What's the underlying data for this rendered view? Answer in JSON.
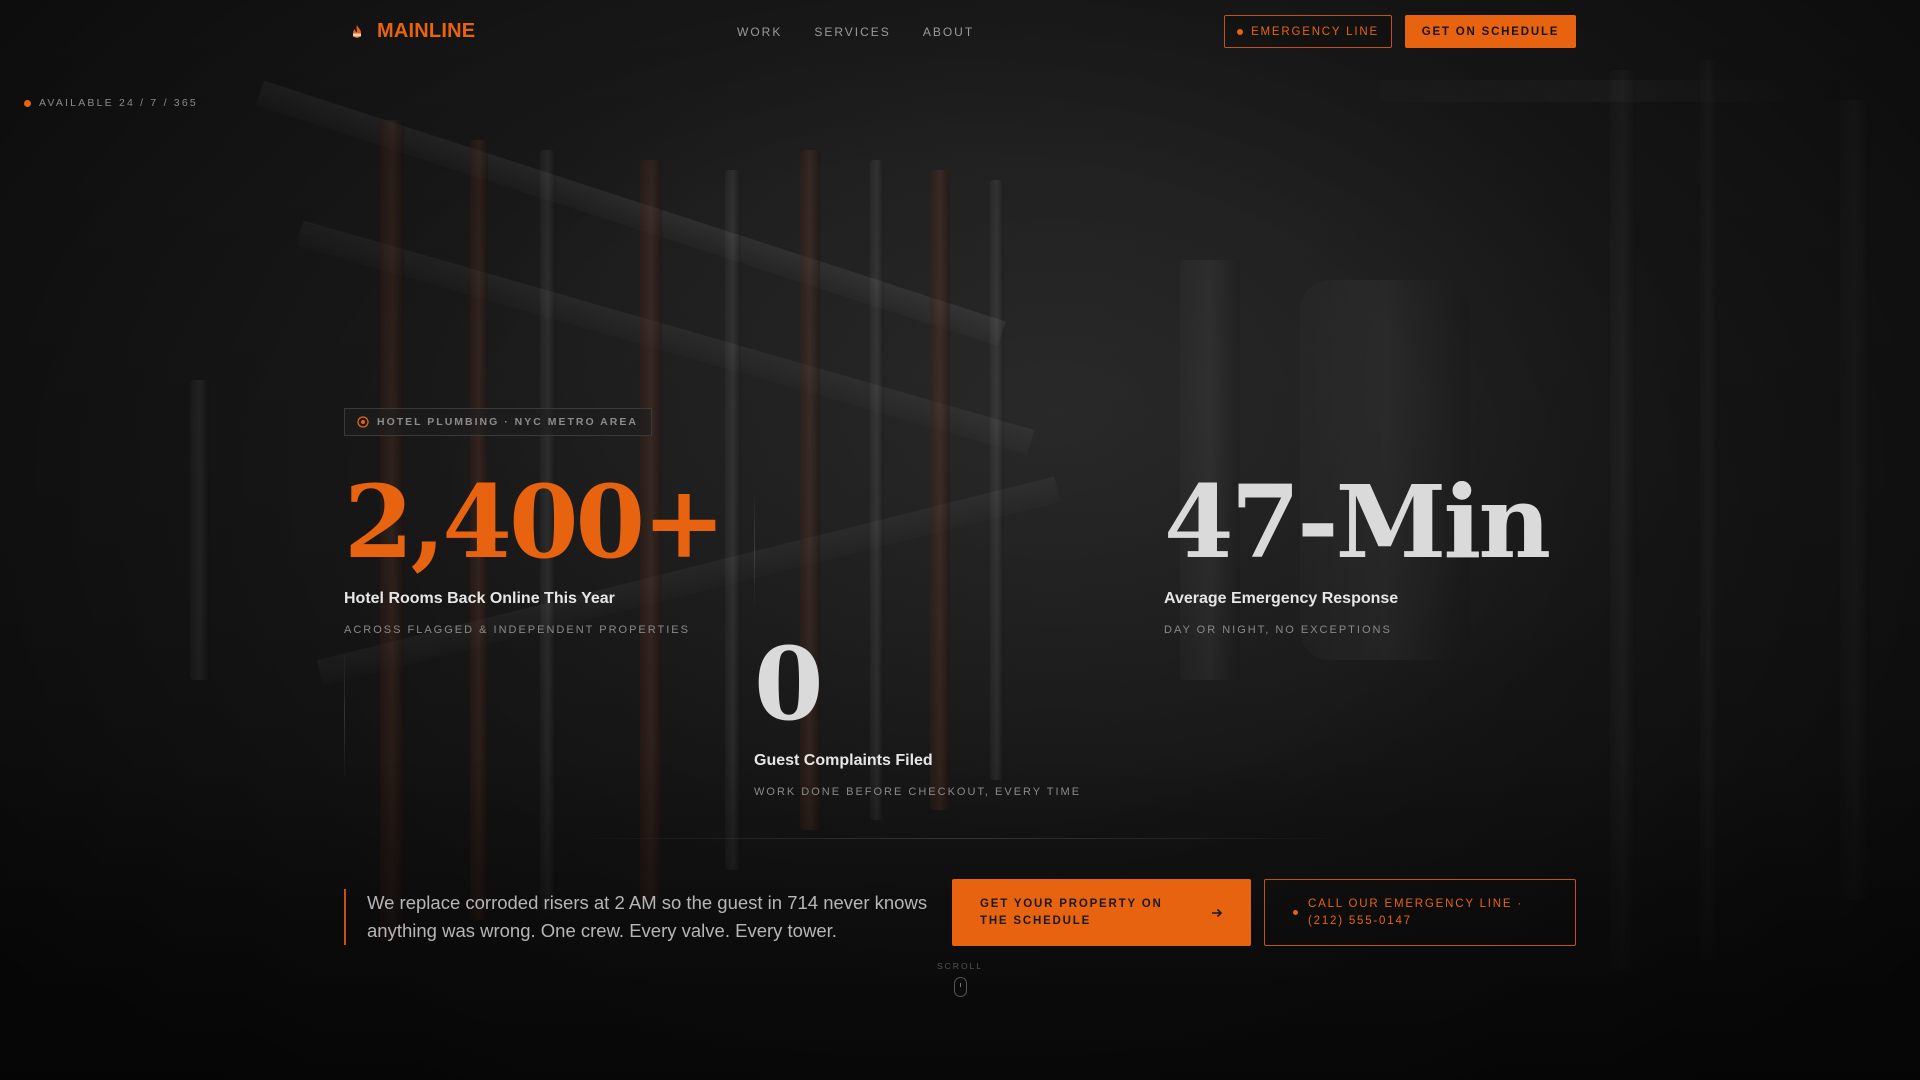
{
  "brand": {
    "name": "MAINLINE",
    "icon": "flame-icon",
    "accent_color": "#e8630f"
  },
  "nav": {
    "links": [
      "WORK",
      "SERVICES",
      "ABOUT"
    ],
    "emergency_label": "EMERGENCY LINE",
    "schedule_label": "GET ON SCHEDULE"
  },
  "availability": "AVAILABLE 24 / 7 / 365",
  "tag": {
    "label": "HOTEL PLUMBING · NYC METRO AREA",
    "icon": "target-icon"
  },
  "stats": [
    {
      "value": "2,400+",
      "label": "Hotel Rooms Back Online This Year",
      "sub": "ACROSS FLAGGED & INDEPENDENT PROPERTIES",
      "color": "#e8630f"
    },
    {
      "value": "47-Min",
      "label": "Average Emergency Response",
      "sub": "DAY OR NIGHT, NO EXCEPTIONS",
      "color": "#dadada"
    },
    {
      "value": "0",
      "label": "Guest Complaints Filed",
      "sub": "WORK DONE BEFORE CHECKOUT, EVERY TIME",
      "color": "#dadada"
    }
  ],
  "quote": "We replace corroded risers at 2 AM so the guest in 714 never knows anything was wrong. One crew. Every valve. Every tower.",
  "cta": {
    "primary_label": "GET YOUR PROPERTY ON THE SCHEDULE",
    "primary_icon": "arrow-right-icon",
    "secondary_label": "CALL OUR EMERGENCY LINE · (212) 555-0147"
  },
  "scroll_label": "SCROLL"
}
